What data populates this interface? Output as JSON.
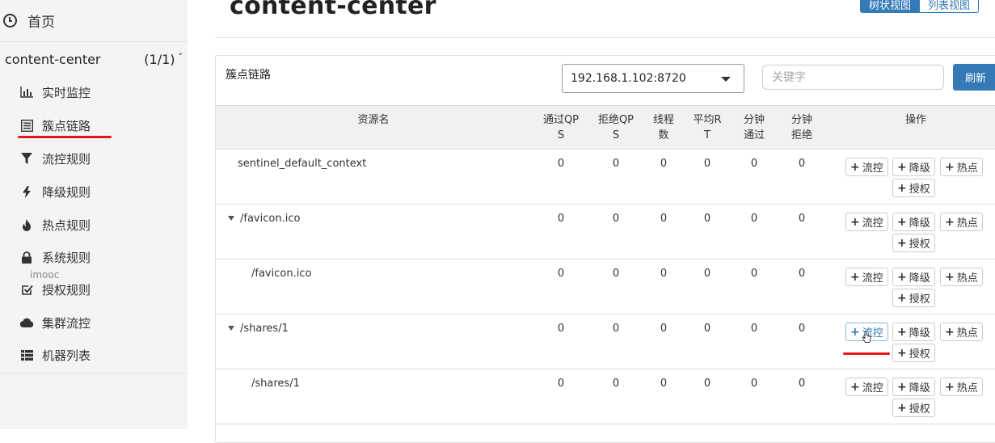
{
  "sidebar": {
    "home_label": "首页",
    "app_name": "content-center",
    "app_count": "(1/1)",
    "chevron": "˅",
    "watermark": "imooc",
    "items": [
      {
        "label": "实时监控",
        "icon": "bar-chart-icon"
      },
      {
        "label": "簇点链路",
        "icon": "list-icon"
      },
      {
        "label": "流控规则",
        "icon": "filter-icon"
      },
      {
        "label": "降级规则",
        "icon": "bolt-icon"
      },
      {
        "label": "热点规则",
        "icon": "fire-icon"
      },
      {
        "label": "系统规则",
        "icon": "lock-icon"
      },
      {
        "label": "授权规则",
        "icon": "check-square-icon"
      },
      {
        "label": "集群流控",
        "icon": "cloud-icon"
      },
      {
        "label": "机器列表",
        "icon": "th-list-icon"
      }
    ]
  },
  "header": {
    "title": "content-center",
    "tree_view": "树状视图",
    "list_view": "列表视图"
  },
  "panel": {
    "label": "簇点链路",
    "machine": "192.168.1.102:8720",
    "search_placeholder": "关键字",
    "refresh": "刷新"
  },
  "table": {
    "headers": {
      "resource": "资源名",
      "pass_qps": [
        "通过QP",
        "S"
      ],
      "block_qps": [
        "拒绝QP",
        "S"
      ],
      "threads": [
        "线程",
        "数"
      ],
      "avg_rt": [
        "平均R",
        "T"
      ],
      "minute_pass": [
        "分钟",
        "通过"
      ],
      "minute_block": [
        "分钟",
        "拒绝"
      ],
      "ops": "操作"
    },
    "buttons": {
      "flow": "流控",
      "degrade": "降级",
      "hot": "热点",
      "auth": "授权"
    },
    "rows": [
      {
        "name": "sentinel_default_context",
        "expandable": false,
        "indent": 0,
        "values": [
          "0",
          "0",
          "0",
          "0",
          "0",
          "0"
        ]
      },
      {
        "name": "/favicon.ico",
        "expandable": true,
        "indent": 0,
        "values": [
          "0",
          "0",
          "0",
          "0",
          "0",
          "0"
        ]
      },
      {
        "name": "/favicon.ico",
        "expandable": false,
        "indent": 1,
        "values": [
          "0",
          "0",
          "0",
          "0",
          "0",
          "0"
        ]
      },
      {
        "name": "/shares/1",
        "expandable": true,
        "indent": 0,
        "values": [
          "0",
          "0",
          "0",
          "0",
          "0",
          "0"
        ]
      },
      {
        "name": "/shares/1",
        "expandable": false,
        "indent": 1,
        "values": [
          "0",
          "0",
          "0",
          "0",
          "0",
          "0"
        ]
      }
    ]
  },
  "colors": {
    "primary": "#337ab7",
    "annotation_red": "#e5161f"
  }
}
